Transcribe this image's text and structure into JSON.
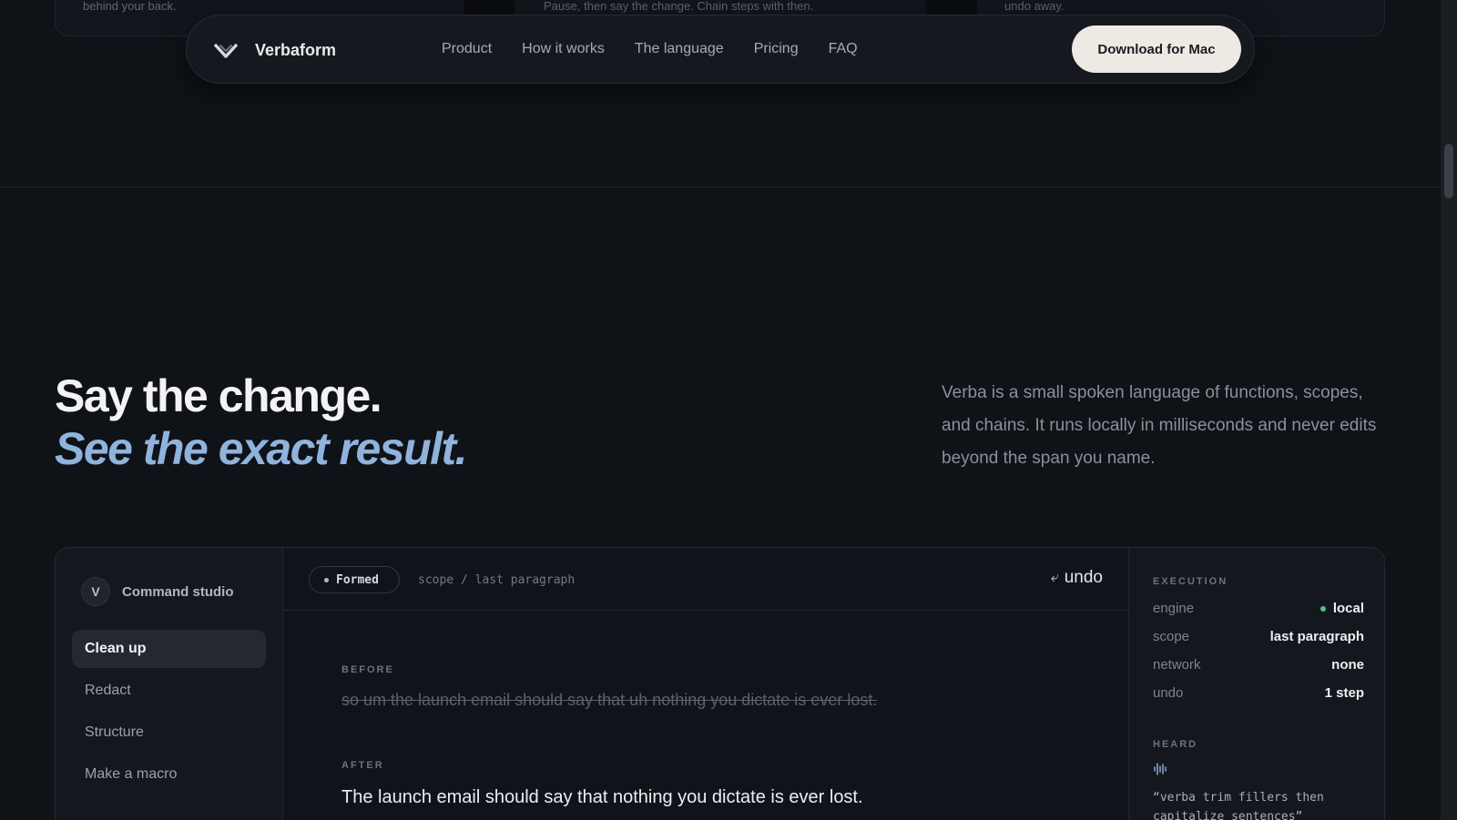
{
  "top_strip": {
    "cells": [
      "behind your back.",
      "Pause, then say the change. Chain steps with then.",
      "undo away."
    ]
  },
  "nav": {
    "brand": "Verbaform",
    "links": [
      "Product",
      "How it works",
      "The language",
      "Pricing",
      "FAQ"
    ],
    "cta": "Download for Mac"
  },
  "hero": {
    "title": "Say the change.",
    "subtitle": "See the exact result.",
    "description": "Verba is a small spoken language of functions, scopes, and chains. It runs locally in milliseconds and never edits beyond the span you name."
  },
  "studio": {
    "avatar_letter": "V",
    "header_label": "Command studio",
    "items": [
      {
        "label": "Clean up",
        "active": true
      },
      {
        "label": "Redact",
        "active": false
      },
      {
        "label": "Structure",
        "active": false
      },
      {
        "label": "Make a macro",
        "active": false
      }
    ],
    "status_pill": "Formed",
    "scope_path": "scope / last paragraph",
    "undo_label": "undo",
    "before_label": "BEFORE",
    "before_text": "so um the launch email should say that uh nothing you dictate is ever lost.",
    "after_label": "AFTER",
    "after_text": "The launch email should say that nothing you dictate is ever lost.",
    "execution": {
      "label": "EXECUTION",
      "rows": [
        {
          "key": "engine",
          "value": "local",
          "status_color": "#4fc48b"
        },
        {
          "key": "scope",
          "value": "last paragraph"
        },
        {
          "key": "network",
          "value": "none"
        },
        {
          "key": "undo",
          "value": "1 step"
        }
      ]
    },
    "heard": {
      "label": "HEARD",
      "icon": "waveform-icon",
      "text": "“verba trim fillers then capitalize sentences”"
    }
  },
  "colors": {
    "background": "#0f1217",
    "accent_blue": "#8fb3dc",
    "cta_bg": "#eeeae3",
    "status_green": "#4fc48b"
  }
}
